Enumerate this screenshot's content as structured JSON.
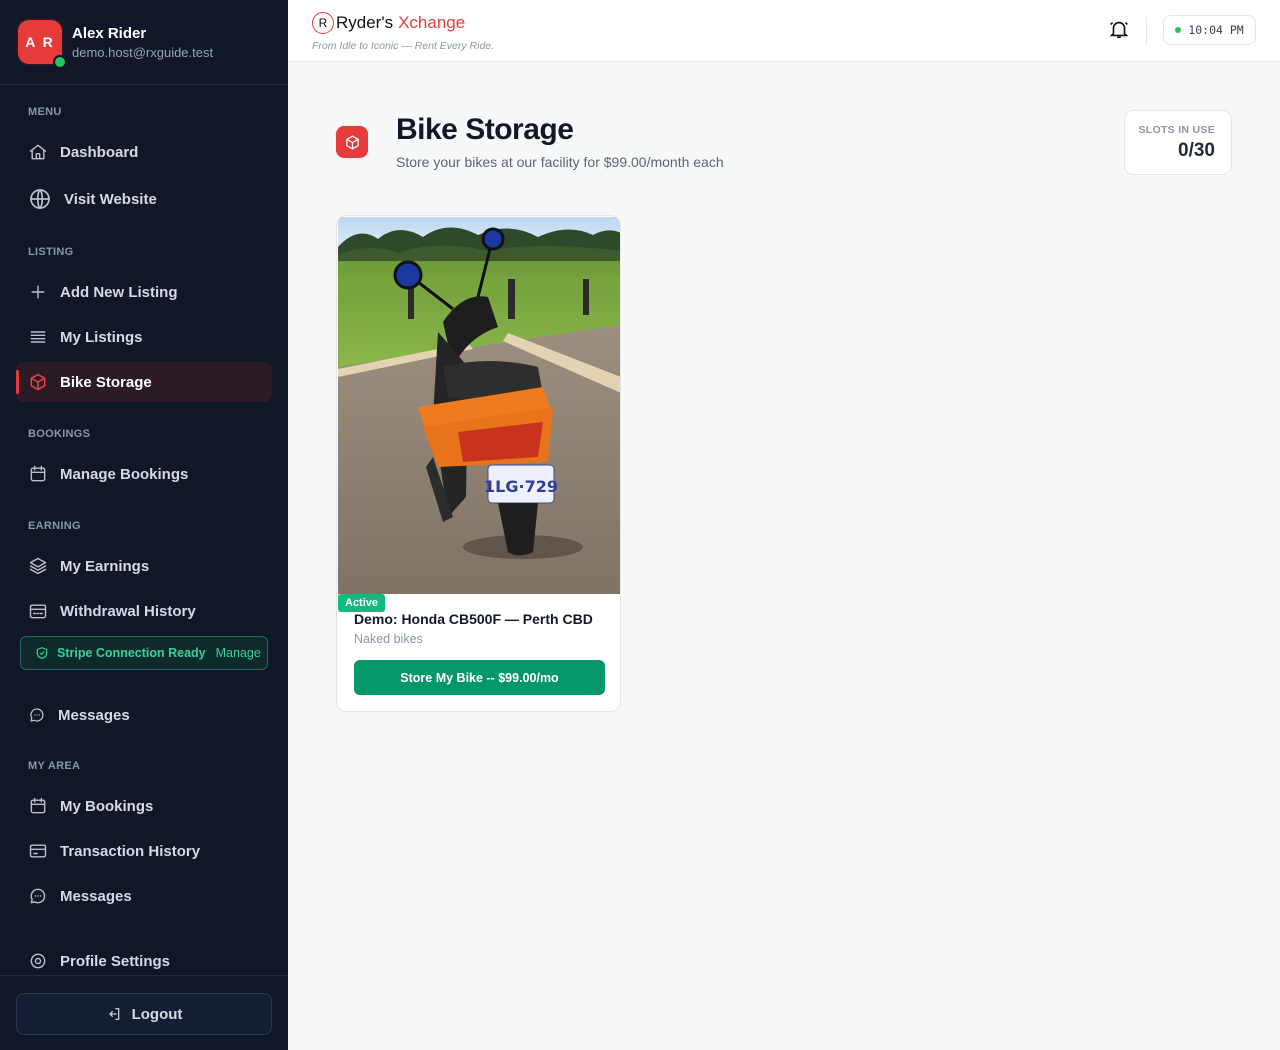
{
  "user": {
    "initials": "A R",
    "name": "Alex Rider",
    "email": "demo.host@rxguide.test"
  },
  "sidebar": {
    "sections": {
      "menu": "MENU",
      "listing": "LISTING",
      "bookings": "BOOKINGS",
      "earning": "EARNING",
      "my_area": "MY AREA"
    },
    "items": {
      "dashboard": "Dashboard",
      "visit_website": "Visit Website",
      "add_listing": "Add New Listing",
      "my_listings": "My Listings",
      "bike_storage": "Bike Storage",
      "manage_bookings": "Manage Bookings",
      "my_earnings": "My Earnings",
      "withdrawal_history": "Withdrawal History",
      "messages_host": "Messages",
      "my_bookings": "My Bookings",
      "transaction_history": "Transaction History",
      "messages_user": "Messages",
      "profile_settings": "Profile Settings"
    },
    "stripe": {
      "status": "Stripe Connection Ready",
      "manage": "Manage"
    },
    "logout": "Logout",
    "active_item": "bike_storage"
  },
  "header": {
    "brand_part1": "Ryder's",
    "brand_part2": "Xchange",
    "logo_letter": "R",
    "tagline": "From Idle to Iconic — Rent Every Ride.",
    "time": "10:04 PM"
  },
  "page": {
    "title": "Bike Storage",
    "subtitle": "Store your bikes at our facility for $99.00/month each",
    "slots_label": "SLOTS IN USE",
    "slots_value": "0/30"
  },
  "listings": [
    {
      "status": "Active",
      "title": "Demo: Honda CB500F — Perth CBD",
      "category": "Naked bikes",
      "plate": "1LG·729",
      "button": "Store My Bike -- $99.00/mo"
    }
  ],
  "colors": {
    "accent": "#e63b3b",
    "success": "#059669",
    "sidebar_bg": "#0f1729"
  }
}
